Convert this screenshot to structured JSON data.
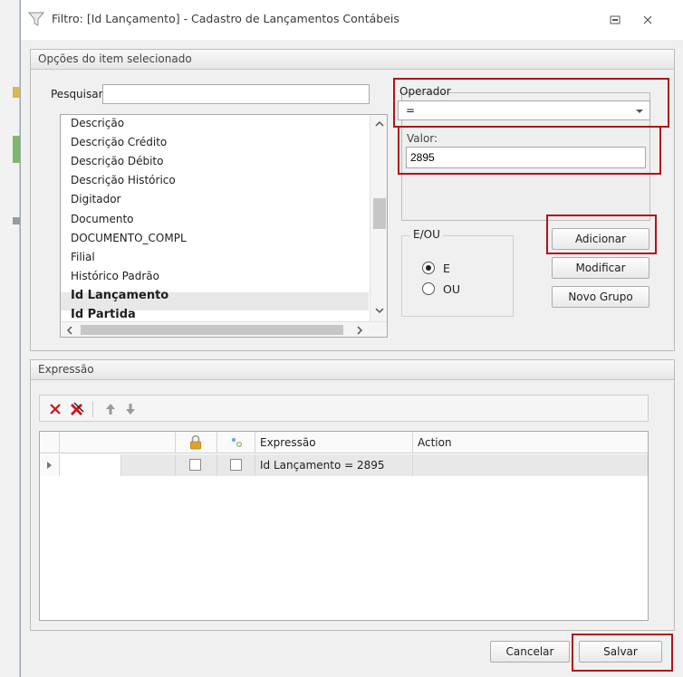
{
  "window": {
    "title": "Filtro: [Id Lançamento] - Cadastro de Lançamentos Contábeis"
  },
  "options_group": {
    "title": "Opções do item selecionado",
    "search_label": "Pesquisar:",
    "search_value": "",
    "fields": [
      {
        "label": "Descrição",
        "bold": false
      },
      {
        "label": "Descrição Crédito",
        "bold": false
      },
      {
        "label": "Descrição Débito",
        "bold": false
      },
      {
        "label": "Descrição Histórico",
        "bold": false
      },
      {
        "label": "Digitador",
        "bold": false
      },
      {
        "label": "Documento",
        "bold": false
      },
      {
        "label": "DOCUMENTO_COMPL",
        "bold": false
      },
      {
        "label": "Filial",
        "bold": false
      },
      {
        "label": "Histórico Padrão",
        "bold": false
      },
      {
        "label": "Id Lançamento",
        "bold": true
      },
      {
        "label": "Id Partida",
        "bold": true
      }
    ],
    "operator_label": "Operador",
    "operator_value": "=",
    "value_label": "Valor:",
    "value_value": "2895",
    "logic": {
      "title": "E/OU",
      "options": [
        {
          "label": "E",
          "checked": true
        },
        {
          "label": "OU",
          "checked": false
        }
      ]
    },
    "buttons": {
      "add": "Adicionar",
      "modify": "Modificar",
      "new_group": "Novo Grupo"
    }
  },
  "expression_group": {
    "title": "Expressão",
    "columns": {
      "expression": "Expressão",
      "action": "Action"
    },
    "rows": [
      {
        "expression": "Id Lançamento = 2895",
        "action": ""
      }
    ]
  },
  "footer": {
    "cancel": "Cancelar",
    "save": "Salvar"
  },
  "colors": {
    "highlight": "#b3121a",
    "selected_row": "#e8e8e8"
  }
}
